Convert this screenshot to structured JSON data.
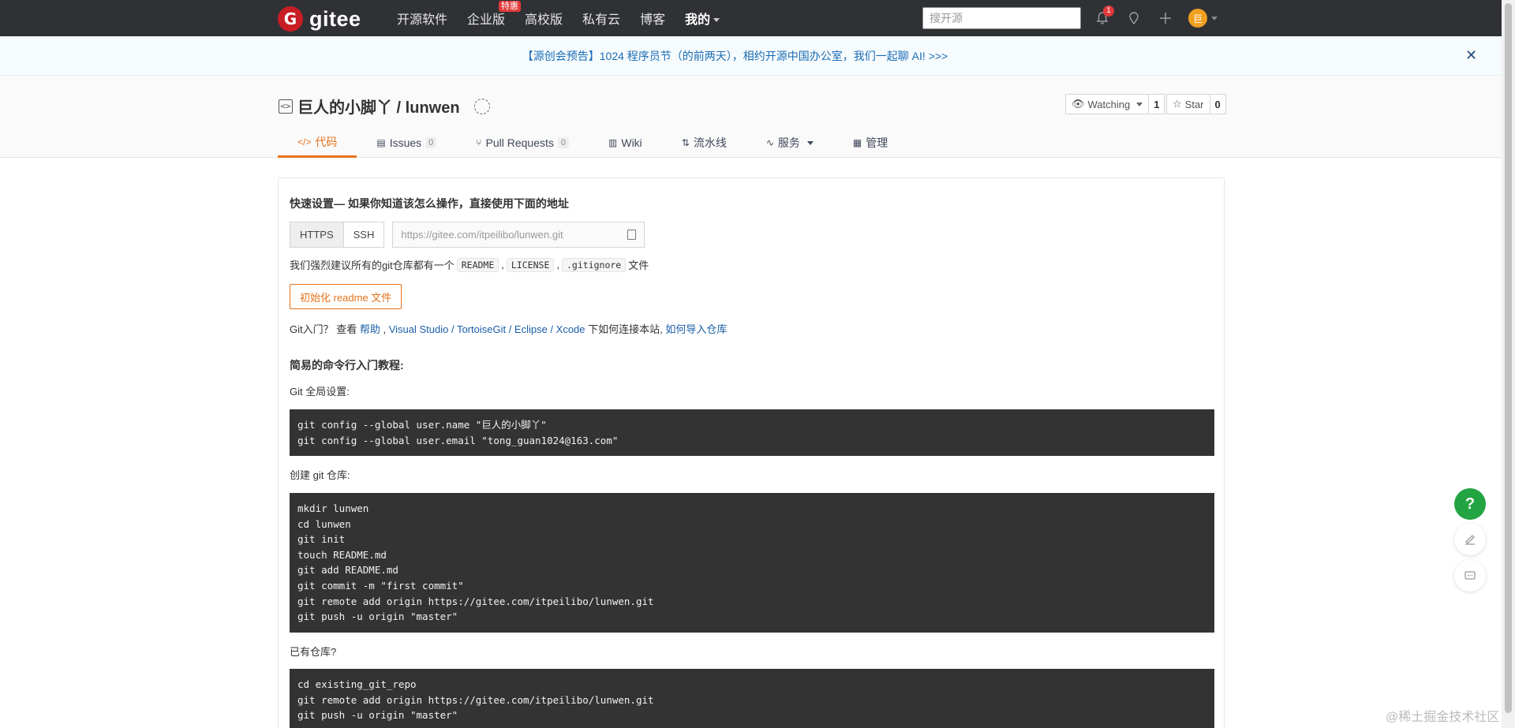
{
  "topnav": {
    "logo_mark": "G",
    "logo_text": "gitee",
    "links": [
      "开源软件",
      "企业版",
      "高校版",
      "私有云",
      "博客"
    ],
    "enterprise_badge": "特惠",
    "mine": "我的",
    "search_placeholder": "搜开源",
    "bell_count": "1",
    "avatar_initial": "巨",
    "icons": [
      "bell-icon",
      "location-icon",
      "plus-icon"
    ]
  },
  "announce": {
    "text": "【源创会预告】1024 程序员节（的前两天），相约开源中国办公室，我们一起聊 AI!  >>>",
    "close": "✕"
  },
  "repo": {
    "title": "巨人的小脚丫 / lunwen",
    "watch_label": "Watching",
    "watch_count": "1",
    "star_label": "Star",
    "star_count": "0"
  },
  "tabs": [
    {
      "label": "代码",
      "icon": "code-icon"
    },
    {
      "label": "Issues",
      "count": "0",
      "icon": "issues-icon"
    },
    {
      "label": "Pull Requests",
      "count": "0",
      "icon": "pr-icon"
    },
    {
      "label": "Wiki",
      "icon": "wiki-icon"
    },
    {
      "label": "流水线",
      "icon": "pipeline-icon"
    },
    {
      "label": "服务",
      "icon": "service-icon"
    },
    {
      "label": "管理",
      "icon": "manage-icon"
    }
  ],
  "quick": {
    "title": "快速设置— 如果你知道该怎么操作，直接使用下面的地址",
    "https": "HTTPS",
    "ssh": "SSH",
    "url": "https://gitee.com/itpeilibo/lunwen.git",
    "suggest_prefix": "我们强烈建议所有的git仓库都有一个",
    "readme": "README",
    "license": "LICENSE",
    "gitignore": ".gitignore",
    "suggest_suffix": "文件",
    "sep": ",",
    "init_btn": "初始化 readme 文件",
    "help_prefix": "Git入门？ 查看 ",
    "help_link": "帮助",
    "help_mid": " , ",
    "tools": "Visual Studio / TortoiseGit / Eclipse / Xcode",
    "help_connect": " 下如何连接本站, ",
    "import_link": "如何导入仓库"
  },
  "cli": {
    "title": "简易的命令行入门教程:",
    "global_label": "Git 全局设置:",
    "global_code": "git config --global user.name \"巨人的小脚丫\"\ngit config --global user.email \"tong_guan1024@163.com\"",
    "create_label": "创建 git 仓库:",
    "create_code": "mkdir lunwen\ncd lunwen\ngit init\ntouch README.md\ngit add README.md\ngit commit -m \"first commit\"\ngit remote add origin https://gitee.com/itpeilibo/lunwen.git\ngit push -u origin \"master\"",
    "existing_label": "已有仓库?",
    "existing_code": "cd existing_git_repo\ngit remote add origin https://gitee.com/itpeilibo/lunwen.git\ngit push -u origin \"master\""
  },
  "floating": {
    "help": "?",
    "edit_icon": "edit-icon",
    "chat_icon": "chat-icon"
  },
  "watermark": "@稀土掘金技术社区"
}
